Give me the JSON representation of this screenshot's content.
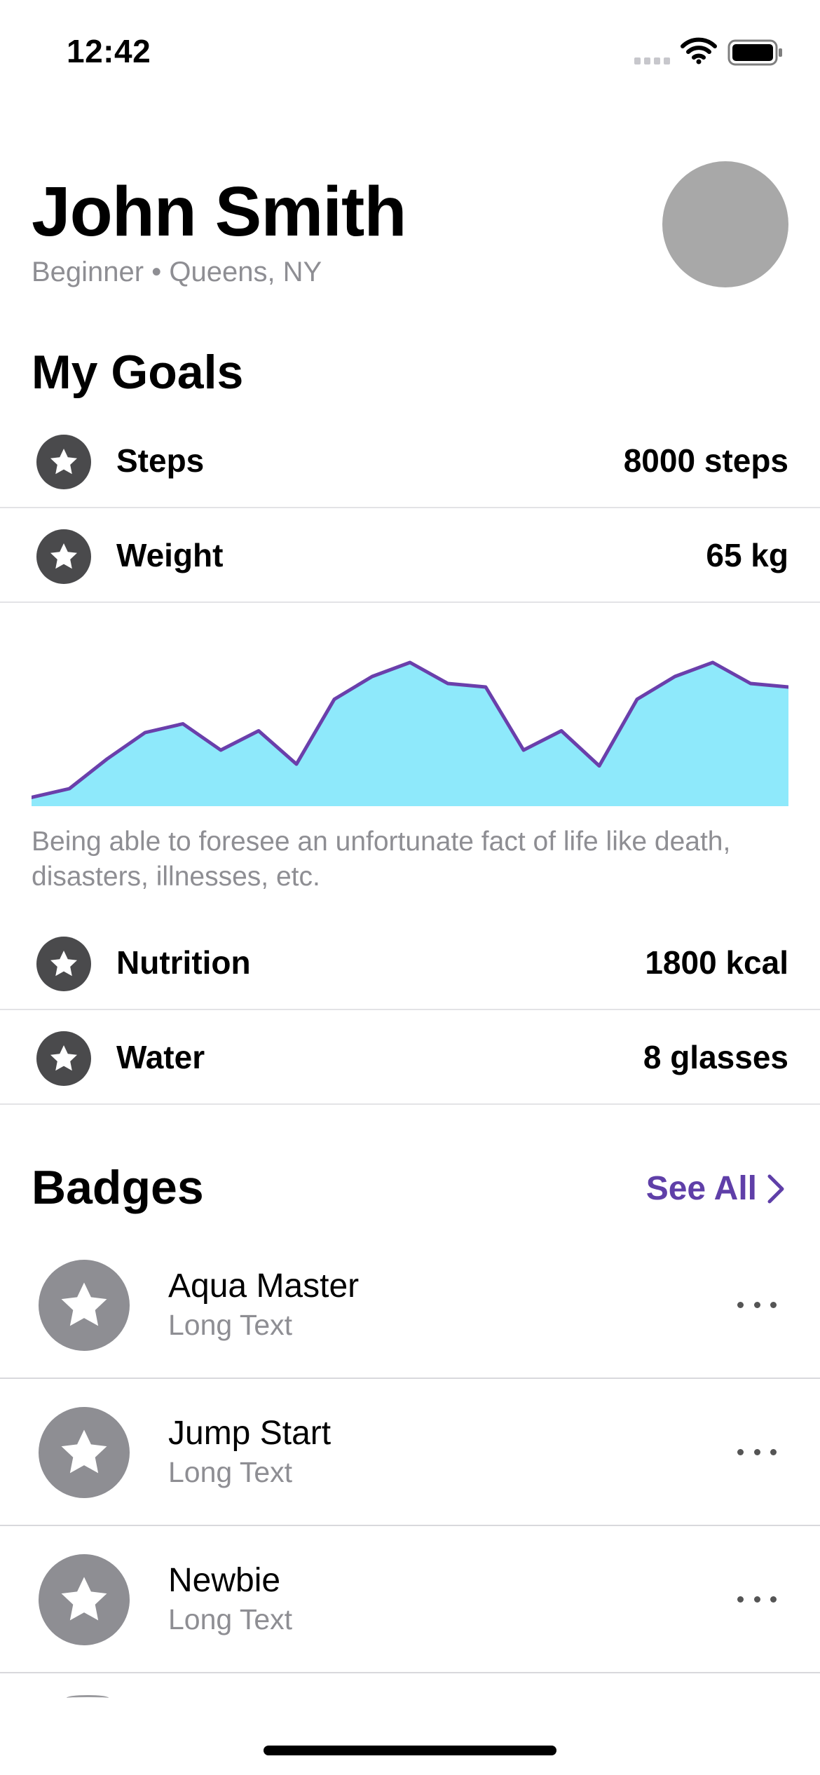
{
  "status_bar": {
    "time": "12:42"
  },
  "profile": {
    "name": "John Smith",
    "subtitle": "Beginner • Queens, NY"
  },
  "goals": {
    "title": "My Goals",
    "items": [
      {
        "label": "Steps",
        "value": "8000 steps",
        "icon": "star-icon"
      },
      {
        "label": "Weight",
        "value": "65 kg",
        "icon": "star-icon"
      },
      {
        "label": "Nutrition",
        "value": "1800 kcal",
        "icon": "star-icon"
      },
      {
        "label": "Water",
        "value": "8 glasses",
        "icon": "star-icon"
      }
    ]
  },
  "chart_data": {
    "type": "area",
    "values": [
      5,
      10,
      27,
      42,
      47,
      32,
      43,
      24,
      61,
      74,
      82,
      70,
      68,
      32,
      43,
      23,
      61,
      74,
      82,
      70,
      68
    ],
    "ylim": [
      0,
      100
    ],
    "fill_color": "#8ee9fb",
    "line_color": "#6a3fab",
    "caption": "Being able to foresee an unfortunate fact of life like death, disasters, illnesses, etc."
  },
  "badges": {
    "title": "Badges",
    "see_all_label": "See All",
    "items": [
      {
        "name": "Aqua Master",
        "detail": "Long Text",
        "icon": "star-icon"
      },
      {
        "name": "Jump Start",
        "detail": "Long Text",
        "icon": "star-icon"
      },
      {
        "name": "Newbie",
        "detail": "Long Text",
        "icon": "star-icon"
      }
    ]
  },
  "colors": {
    "accent": "#5f3fa8",
    "goal_icon_bg": "#4a4a4c",
    "badge_icon_bg": "#8e8e93",
    "avatar_bg": "#a8a8a8"
  }
}
